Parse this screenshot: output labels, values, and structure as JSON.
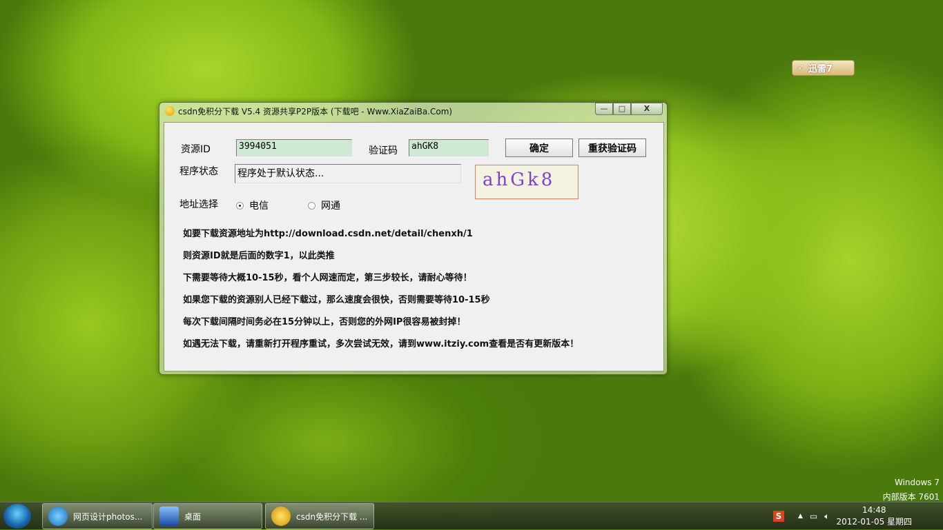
{
  "desktop": {
    "xunlei_label": "迅雷7",
    "watermark_os": "Windows 7",
    "watermark_build": "内部版本 7601"
  },
  "window": {
    "title": "csdn免积分下载 V5.4 资源共享P2P版本 (下载吧 - Www.XiaZaiBa.Com)",
    "minimize": "—",
    "maximize": "□",
    "close": "X"
  },
  "form": {
    "resource_id_label": "资源ID",
    "resource_id_value": "3994051",
    "captcha_label": "验证码",
    "captcha_value": "ahGK8",
    "confirm_button": "确定",
    "refresh_captcha_button": "重获验证码",
    "status_label": "程序状态",
    "status_value": "程序处于默认状态...",
    "captcha_image_text": "ahGk8",
    "address_label": "地址选择",
    "radio_telecom": "电信",
    "radio_netcom": "网通",
    "selected": "电信"
  },
  "instructions": [
    "如要下载资源地址为http://download.csdn.net/detail/chenxh/1",
    "则资源ID就是后面的数字1，以此类推",
    "下需要等待大概10-15秒，看个人网速而定，第三步较长，请耐心等待！",
    "如果您下载的资源别人已经下载过，那么速度会很快，否则需要等待10-15秒",
    "每次下载间隔时间务必在15分钟以上，否则您的外网IP很容易被封掉！",
    "如遇无法下载，请重新打开程序重试，多次尝试无效，请到www.itziy.com查看是否有更新版本！"
  ],
  "taskbar": {
    "items": [
      "网页设计photos...",
      "桌面",
      "csdn免积分下载 ..."
    ],
    "time": "14:48",
    "date": "2012-01-05 星期四",
    "ime": "S",
    "tray_arrow": "▲"
  }
}
